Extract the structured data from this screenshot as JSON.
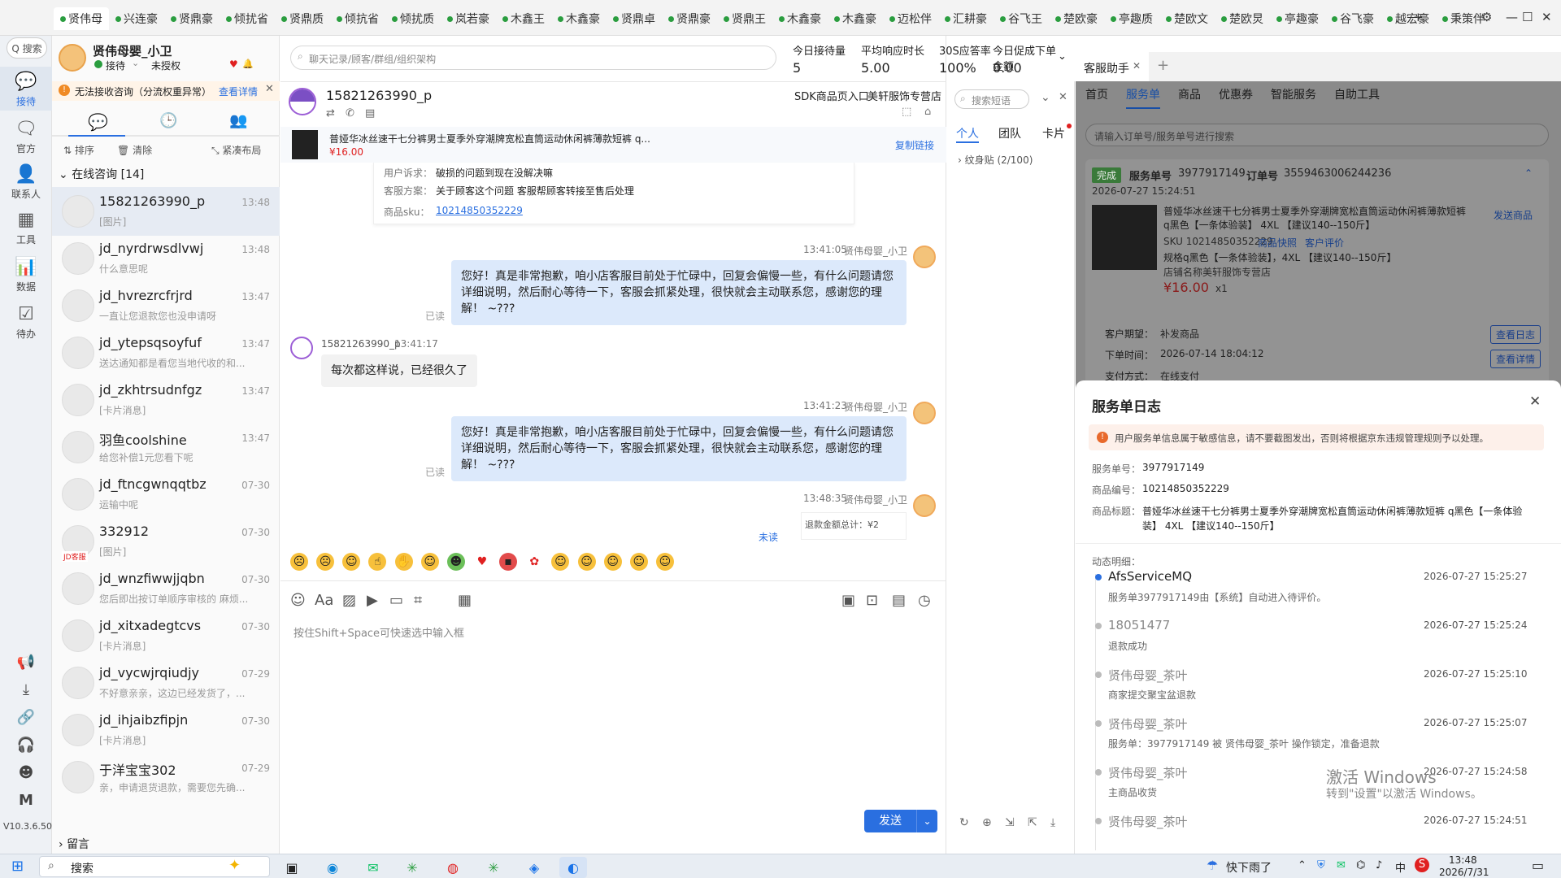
{
  "top_tabs": [
    "贤伟母",
    "兴连豪",
    "贤鼎豪",
    "倾扰省",
    "贤鼎质",
    "倾抗省",
    "倾扰质",
    "岚若豪",
    "木鑫王",
    "木鑫豪",
    "贤鼎卓",
    "贤鼎豪",
    "贤鼎王",
    "木鑫豪",
    "木鑫豪",
    "迈松伴",
    "汇耕豪",
    "谷飞王",
    "楚欧豪",
    "亭趣质",
    "楚欧文",
    "楚欧炅",
    "亭趣豪",
    "谷飞豪",
    "越宏豪",
    "秉策伴"
  ],
  "window_controls": {
    "add": "+",
    "settings": "⚙",
    "minimize": "—",
    "maximize": "☐",
    "close": "✕"
  },
  "rail": {
    "search": "Q 搜索",
    "items": [
      {
        "label": "接待",
        "icon": "chat-icon"
      },
      {
        "label": "官方",
        "icon": "message-icon"
      },
      {
        "label": "联系人",
        "icon": "contacts-icon"
      },
      {
        "label": "工具",
        "icon": "tools-icon"
      },
      {
        "label": "数据",
        "icon": "data-icon"
      },
      {
        "label": "待办",
        "icon": "todo-icon"
      }
    ],
    "bottom": {
      "m": "M",
      "version": "V10.3.6.500"
    }
  },
  "profile": {
    "name": "贤伟母婴_小卫",
    "status": "接待",
    "auth": "未授权"
  },
  "notice": {
    "text": "无法接收咨询（分流权重异常）",
    "link": "查看详情"
  },
  "list_toolbar": {
    "sort": "排序",
    "clear": "清除",
    "layout": "紧凑布局"
  },
  "list_group": "在线咨询 [14]",
  "conversations": [
    {
      "name": "15821263990_p",
      "preview": "[图片]",
      "time": "13:48"
    },
    {
      "name": "jd_nyrdrwsdlvwj",
      "preview": "什么意思呢",
      "time": "13:48"
    },
    {
      "name": "jd_hvrezrcfrjrd",
      "preview": "一直让您退款您也没申请呀",
      "time": "13:47"
    },
    {
      "name": "jd_ytepsqsoyfuf",
      "preview": "送达通知都是看您当地代收的和...",
      "time": "13:47"
    },
    {
      "name": "jd_zkhtrsudnfgz",
      "preview": "[卡片消息]",
      "time": "13:47"
    },
    {
      "name": "羽鱼coolshine",
      "preview": "给您补偿1元您看下呢",
      "time": "13:47"
    },
    {
      "name": "jd_ftncgwnqqtbz",
      "preview": "运输中呢",
      "time": "07-30"
    },
    {
      "name": "332912",
      "preview": "[图片]",
      "time": "07-30",
      "badge": "JD客服"
    },
    {
      "name": "jd_wnzfiwwjjqbn",
      "preview": "您后即出按订单顺序审核的 麻烦...",
      "time": "07-30"
    },
    {
      "name": "jd_xitxadegtcvs",
      "preview": "[卡片消息]",
      "time": "07-30"
    },
    {
      "name": "jd_vycwjrqiudjy",
      "preview": "不好意亲亲，这边已经发货了，...",
      "time": "07-29"
    },
    {
      "name": "jd_ihjaibzfipjn",
      "preview": "[卡片消息]",
      "time": "07-30"
    },
    {
      "name": "于洋宝宝302",
      "preview": "亲，申请退货退款，需要您先确...",
      "time": "07-29"
    }
  ],
  "leave_msg": "留言",
  "chat_search": {
    "placeholder": "聊天记录/顾客/群组/组织架构"
  },
  "stats": [
    {
      "label": "今日接待量",
      "value": "5"
    },
    {
      "label": "平均响应时长",
      "value": "5.00"
    },
    {
      "label": "30S应答率",
      "value": "100%"
    },
    {
      "label": "今日促成下单金额",
      "value": "0.00"
    }
  ],
  "chat_header": {
    "customer": "15821263990_p",
    "sdk": "SDK商品页入口",
    "shop": "美轩服饰专营店"
  },
  "product_strip": {
    "title": "普娅华冰丝速干七分裤男士夏季外穿潮牌宽松直筒运动休闲裤薄款短裤 q...",
    "price": "¥16.00",
    "copy": "复制链接"
  },
  "card": {
    "complaint_label": "用户诉求：",
    "complaint": "破损的问题到现在没解决嘛",
    "plan_label": "客服方案：",
    "plan": "关于顾客这个问题 客服帮顾客转接至售后处理",
    "sku_label": "商品sku：",
    "sku": "10214850352229"
  },
  "messages": [
    {
      "side": "agent",
      "time": "13:41:05",
      "sender": "贤伟母婴_小卫",
      "text": "您好！真是非常抱歉，咱小店客服目前处于忙碌中，回复会偏慢一些，有什么问题请您详细说明，然后耐心等待一下，客服会抓紧处理，很快就会主动联系您，感谢您的理解！ ~???",
      "read": "已读"
    },
    {
      "side": "customer",
      "time": "13:41:17",
      "sender": "15821263990_p",
      "text": "每次都这样说，已经很久了"
    },
    {
      "side": "agent",
      "time": "13:41:23",
      "sender": "贤伟母婴_小卫",
      "text": "您好！真是非常抱歉，咱小店客服目前处于忙碌中，回复会偏慢一些，有什么问题请您详细说明，然后耐心等待一下，客服会抓紧处理，很快就会主动联系您，感谢您的理解！ ~???",
      "read": "已读"
    },
    {
      "side": "agent",
      "time": "13:48:35",
      "sender": "贤伟母婴_小卫",
      "text": "退款金额总计：¥2",
      "read": "未读"
    }
  ],
  "composer": {
    "placeholder": "按住Shift+Space可快速选中输入框",
    "send": "发送"
  },
  "quick": {
    "search": "搜索短语",
    "tabs": [
      "个人",
      "团队",
      "卡片"
    ],
    "folder": "纹身贴 (2/100)"
  },
  "right_tab": {
    "title": "客服助手",
    "add": "+"
  },
  "right_nav": [
    "首页",
    "服务单",
    "商品",
    "优惠券",
    "智能服务",
    "自助工具"
  ],
  "right_search": {
    "placeholder": "请输入订单号/服务单号进行搜索"
  },
  "service_card": {
    "status": "完成",
    "service_no_label": "服务单号",
    "service_no": "3977917149",
    "order_no_label": "订单号",
    "order_no": "3559463006244236",
    "created": "2026-07-27 15:24:51",
    "title": "普娅华冰丝速干七分裤男士夏季外穿潮牌宽松直筒运动休闲裤薄款短裤 q黑色【一条体验装】 4XL 【建议140--150斤】",
    "send_goods": "发送商品",
    "sku": "SKU 10214850352229",
    "snapshot": "商品快照",
    "review": "客户评价",
    "spec": "规格q黑色【一条体验装】，4XL 【建议140--150斤】",
    "shop": "店铺名称美轩服饰专营店",
    "price": "¥16.00",
    "qty": "x1",
    "expect_label": "客户期望：",
    "expect": "补发商品",
    "order_time_label": "下单时间：",
    "order_time": "2026-07-14 18:04:12",
    "pay_label": "支付方式：",
    "pay": "在线支付",
    "log_btn": "查看日志",
    "detail_btn": "查看详情"
  },
  "service_log": {
    "title": "服务单日志",
    "warning": "用户服务单信息属于敏感信息，请不要截图发出，否则将根据京东违规管理规则予以处理。",
    "service_no_label": "服务单号：",
    "service_no": "3977917149",
    "product_no_label": "商品编号：",
    "product_no": "10214850352229",
    "product_title_label": "商品标题：",
    "product_title": "普娅华冰丝速干七分裤男士夏季外穿潮牌宽松直筒运动休闲裤薄款短裤 q黑色【一条体验装】 4XL 【建议140--150斤】",
    "dynamic_label": "动态明细：",
    "entries": [
      {
        "actor": "AfsServiceMQ",
        "time": "2026-07-27 15:25:27",
        "desc": "服务单3977917149由【系统】自动进入待评价。"
      },
      {
        "actor": "18051477",
        "time": "2026-07-27 15:25:24",
        "desc": "退款成功"
      },
      {
        "actor": "贤伟母婴_茶叶",
        "time": "2026-07-27 15:25:10",
        "desc": "商家提交聚宝盆退款"
      },
      {
        "actor": "贤伟母婴_茶叶",
        "time": "2026-07-27 15:25:07",
        "desc": "服务单：3977917149 被 贤伟母婴_茶叶 操作锁定，准备退款"
      },
      {
        "actor": "贤伟母婴_茶叶",
        "time": "2026-07-27 15:24:58",
        "desc": "主商品收货"
      },
      {
        "actor": "贤伟母婴_茶叶",
        "time": "2026-07-27 15:24:51",
        "desc": ""
      }
    ],
    "watermark1": "激活 Windows",
    "watermark2": "转到\"设置\"以激活 Windows。"
  },
  "taskbar": {
    "search": "搜索",
    "weather": "快下雨了",
    "ime": "中",
    "time": "13:48",
    "date": "2026/7/31"
  },
  "colors": {
    "accent": "#2a6fe0",
    "red": "#e02020",
    "green": "#2a9d3f"
  }
}
